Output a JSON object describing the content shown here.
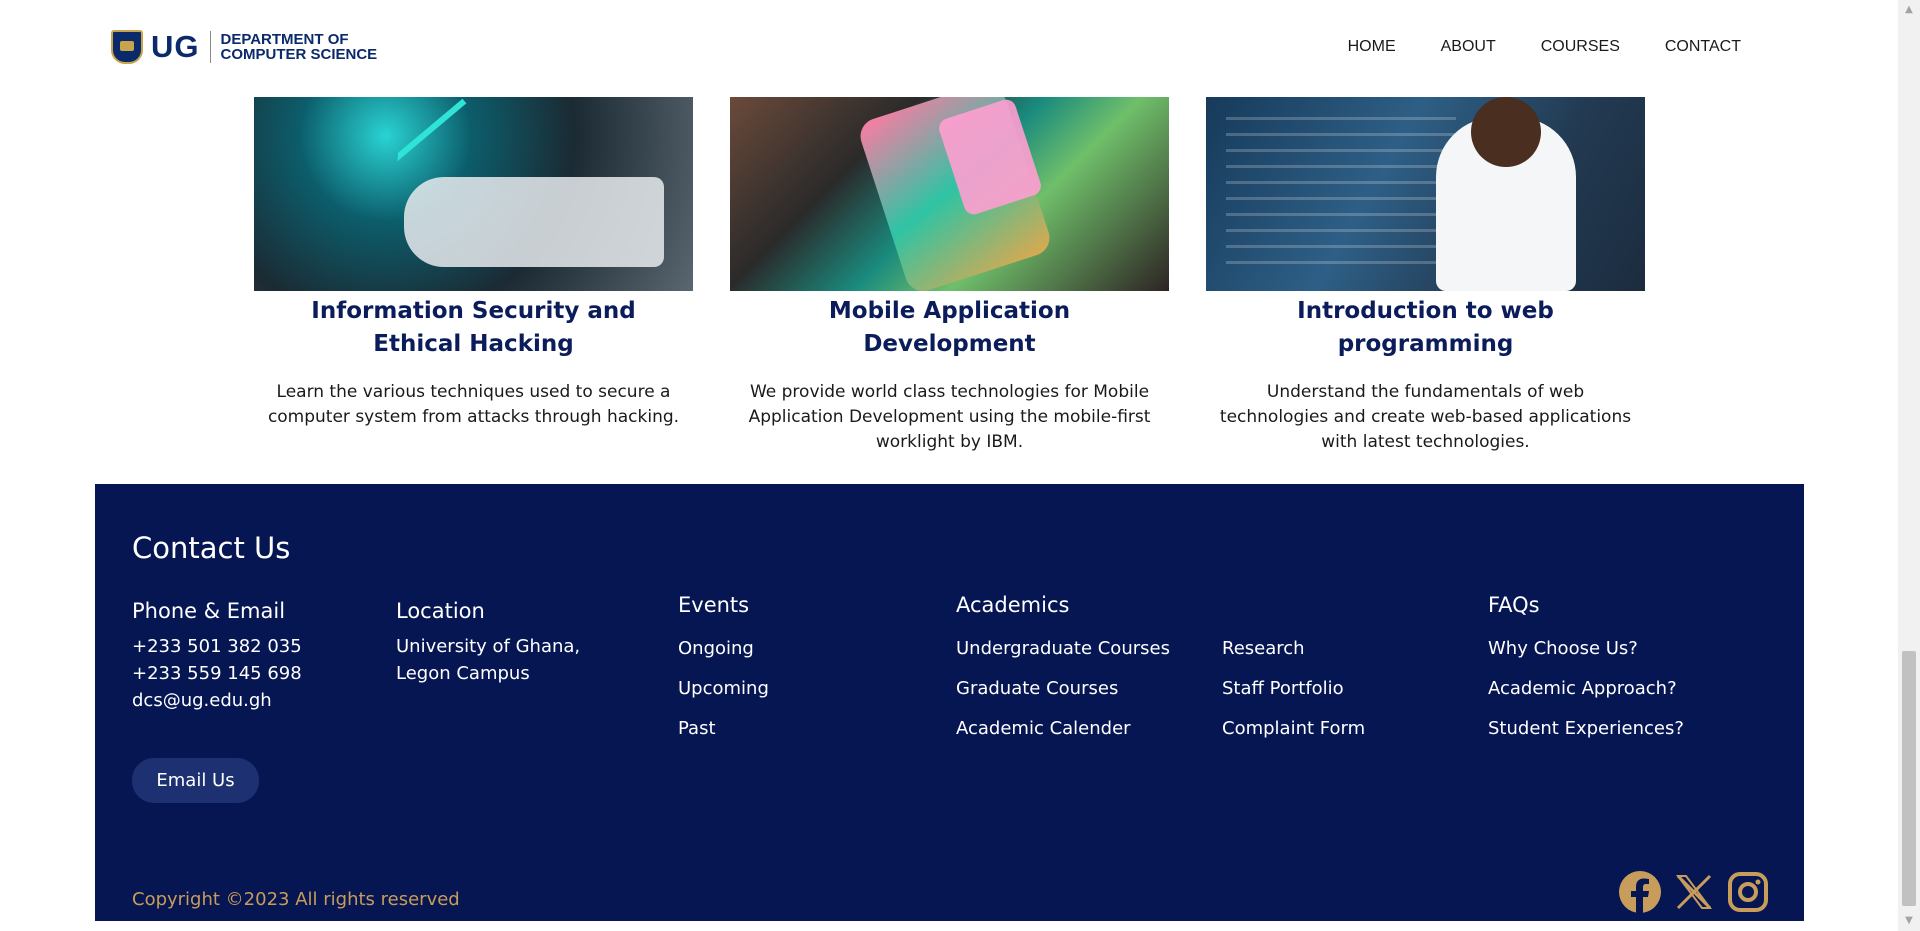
{
  "header": {
    "logo_ug": "UG",
    "logo_dept_line1": "DEPARTMENT OF",
    "logo_dept_line2": "COMPUTER SCIENCE",
    "nav": [
      "HOME",
      "ABOUT",
      "COURSES",
      "CONTACT"
    ]
  },
  "courses": [
    {
      "title": "Information Security and Ethical Hacking",
      "description": "Learn the various techniques used to secure a computer system from attacks through hacking."
    },
    {
      "title": "Mobile Application Development",
      "description": "We provide world class technologies for Mobile Application Development using the mobile-first worklight by IBM."
    },
    {
      "title": "Introduction to web programming",
      "description": "Understand the fundamentals of web technologies and create web-based applications with latest technologies."
    }
  ],
  "footer": {
    "title": "Contact Us",
    "phone_email": {
      "heading": "Phone & Email",
      "lines": [
        "+233 501 382 035",
        "+233 559 145 698",
        "dcs@ug.edu.gh"
      ]
    },
    "location": {
      "heading": "Location",
      "lines": [
        "University of Ghana,",
        "Legon Campus"
      ]
    },
    "events": {
      "heading": "Events",
      "items": [
        "Ongoing",
        "Upcoming",
        "Past"
      ]
    },
    "academics": {
      "heading": "Academics",
      "items_col1": [
        "Undergraduate Courses",
        "Graduate Courses",
        "Academic Calender"
      ],
      "items_col2": [
        "Research",
        "Staff Portfolio",
        "Complaint Form"
      ]
    },
    "faqs": {
      "heading": "FAQs",
      "items": [
        "Why Choose Us?",
        "Academic Approach?",
        "Student Experiences?"
      ]
    },
    "email_button": "Email Us",
    "copyright": "Copyright ©2023 All rights reserved",
    "social_icons": [
      "facebook-icon",
      "x-icon",
      "instagram-icon"
    ]
  },
  "colors": {
    "footer_bg": "#051653",
    "title_navy": "#0b1c5b",
    "copyright_gold": "#c89c5a",
    "social_gold": "#c89c5a"
  }
}
